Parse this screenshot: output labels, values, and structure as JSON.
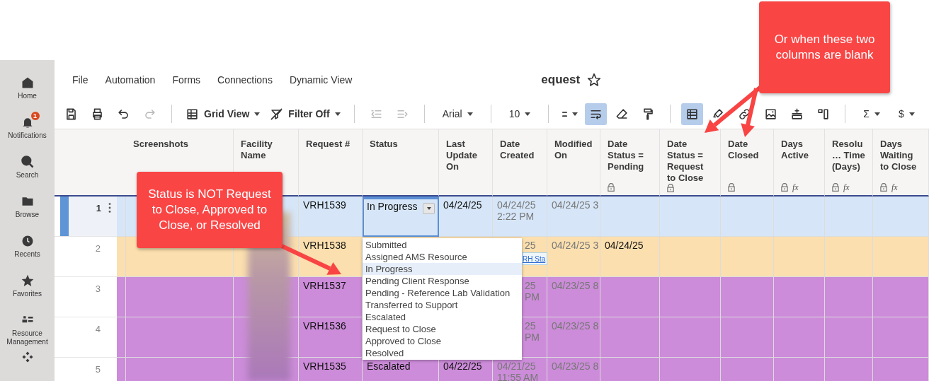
{
  "sidebar": {
    "items": [
      {
        "label": "Home"
      },
      {
        "label": "Notifications",
        "badge": "1"
      },
      {
        "label": "Search"
      },
      {
        "label": "Browse"
      },
      {
        "label": "Recents"
      },
      {
        "label": "Favorites"
      },
      {
        "label": "Resource Management"
      },
      {
        "kind": "icon_only"
      }
    ]
  },
  "menu": [
    "File",
    "Automation",
    "Forms",
    "Connections",
    "Dynamic View"
  ],
  "sheet": {
    "title": "equest",
    "starred": false
  },
  "toolbar": [
    {
      "kind": "icon",
      "active": false,
      "disabled": false
    },
    {
      "kind": "icon",
      "active": false,
      "disabled": false
    },
    {
      "kind": "icon",
      "active": false,
      "disabled": false
    },
    {
      "kind": "icon",
      "active": false,
      "disabled": true
    },
    {
      "kind": "separator"
    },
    {
      "kind": "dropdown",
      "label": "Grid View"
    },
    {
      "kind": "dropdown",
      "label": "Filter Off"
    },
    {
      "kind": "separator"
    },
    {
      "kind": "icon",
      "active": false,
      "disabled": true
    },
    {
      "kind": "icon",
      "active": false,
      "disabled": true
    },
    {
      "kind": "separator"
    },
    {
      "kind": "dropdown",
      "label": "Arial"
    },
    {
      "kind": "separator"
    },
    {
      "kind": "dropdown",
      "label": "10"
    },
    {
      "kind": "separator"
    },
    {
      "kind": "dropdown"
    },
    {
      "kind": "icon",
      "active": true,
      "disabled": false
    },
    {
      "kind": "icon",
      "active": false,
      "disabled": false
    },
    {
      "kind": "icon",
      "active": false,
      "disabled": false
    },
    {
      "kind": "separator"
    },
    {
      "kind": "icon",
      "active": true,
      "disabled": false
    },
    {
      "kind": "icon",
      "active": false,
      "disabled": false
    },
    {
      "kind": "icon",
      "active": false,
      "disabled": false
    },
    {
      "kind": "icon",
      "active": false,
      "disabled": false
    },
    {
      "kind": "icon",
      "active": false,
      "disabled": false
    },
    {
      "kind": "icon",
      "active": false,
      "disabled": false
    },
    {
      "kind": "separator"
    },
    {
      "kind": "dropdown",
      "label": "Σ"
    },
    {
      "kind": "dropdown",
      "label": "$"
    }
  ],
  "columns": [
    {
      "label": "Screenshots",
      "locked": false
    },
    {
      "label": "Facility Name",
      "locked": false
    },
    {
      "label": "Request #",
      "locked": false
    },
    {
      "label": "Status",
      "locked": false
    },
    {
      "label": "Last Update On",
      "locked": false
    },
    {
      "label": "Date Created",
      "locked": false
    },
    {
      "label": "Modified On",
      "locked": false
    },
    {
      "label": "Date Status = Pending",
      "locked": true
    },
    {
      "label": "Date Status = Request to Close",
      "locked": true
    },
    {
      "label": "Date Closed",
      "locked": true
    },
    {
      "label": "Days Active",
      "locked": true,
      "formula_mark": "fx"
    },
    {
      "label": "Resolu… Time (Days)",
      "locked": true,
      "formula_mark": "fx"
    },
    {
      "label": "Days Waiting to Close",
      "locked": true,
      "formula_mark": "fx"
    }
  ],
  "rows": [
    {
      "number": "1",
      "selected": true,
      "request_number": "VRH1539",
      "status": "In Progress",
      "last_update_on": "04/24/25",
      "date_created": "04/24/25 2:22 PM",
      "modified_on": "04/24/25 3"
    },
    {
      "number": "2",
      "selected": false,
      "color": "#fbdfae",
      "request_number": "VRH1538",
      "date_created": "25",
      "link_preview": "RH Sta",
      "modified_on": "04/24/25 3",
      "date_status_pending": "04/24/25"
    },
    {
      "number": "3",
      "selected": false,
      "color": "#cc8cd9",
      "request_number": "VRH1537",
      "date_created": "25 PM",
      "modified_on": "04/23/25 8"
    },
    {
      "number": "4",
      "selected": false,
      "color": "#cc8cd9",
      "request_number": "VRH1536",
      "date_created": "25 PM",
      "modified_on": "04/23/25 8"
    },
    {
      "number": "5",
      "selected": false,
      "color": "#cc8cd9",
      "request_number": "VRH1535",
      "status": "Escalated",
      "last_update_on": "04/22/25",
      "date_created": "04/21/25 11:55 AM",
      "modified_on": "04/23/25 8"
    }
  ],
  "status_dropdown": {
    "options": [
      {
        "label": "Submitted",
        "selected": false
      },
      {
        "label": "Assigned AMS Resource",
        "selected": false
      },
      {
        "label": "In Progress",
        "selected": true
      },
      {
        "label": "Pending Client Response",
        "selected": false
      },
      {
        "label": "Pending - Reference Lab Validation",
        "selected": false
      },
      {
        "label": "Transferred to Support",
        "selected": false
      },
      {
        "label": "Escalated",
        "selected": false
      },
      {
        "label": "Request to Close",
        "selected": false
      },
      {
        "label": "Approved to Close",
        "selected": false
      },
      {
        "label": "Resolved",
        "selected": false
      }
    ]
  },
  "callouts": [
    {
      "text": "Status is NOT Request to Close, Approved to Close, or Resolved"
    },
    {
      "text": "Or when these two columns are blank"
    }
  ]
}
